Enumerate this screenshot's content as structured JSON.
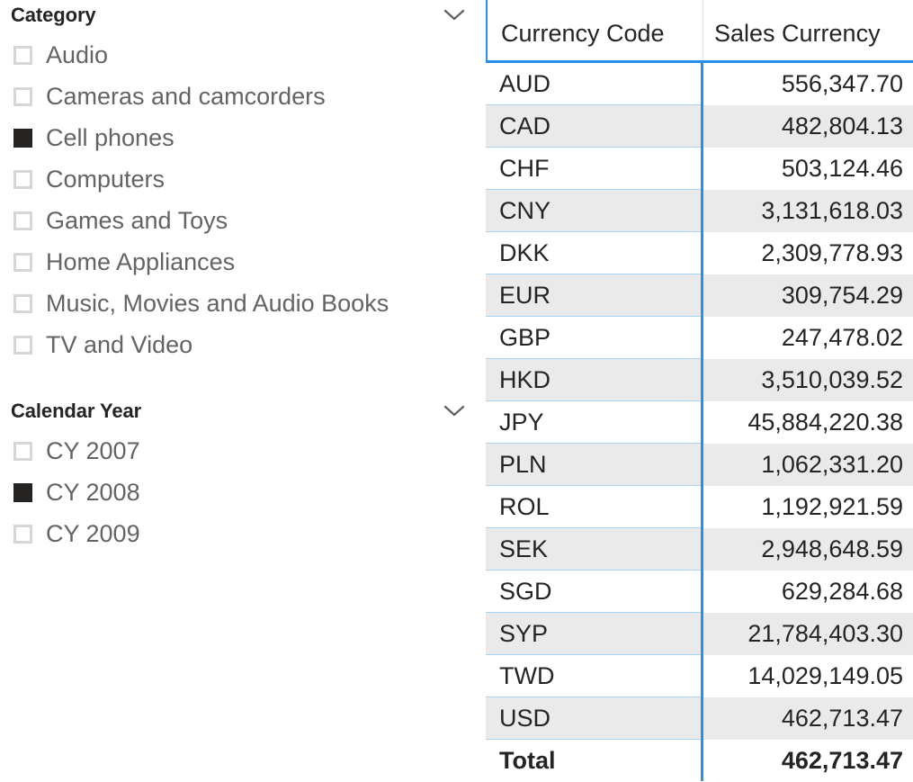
{
  "slicers": [
    {
      "title": "Category",
      "collapse_icon": "chevron-down-icon",
      "items": [
        {
          "label": "Audio",
          "selected": false
        },
        {
          "label": "Cameras and camcorders",
          "selected": false
        },
        {
          "label": "Cell phones",
          "selected": true
        },
        {
          "label": "Computers",
          "selected": false
        },
        {
          "label": "Games and Toys",
          "selected": false
        },
        {
          "label": "Home Appliances",
          "selected": false
        },
        {
          "label": "Music, Movies and Audio Books",
          "selected": false
        },
        {
          "label": "TV and Video",
          "selected": false
        }
      ]
    },
    {
      "title": "Calendar Year",
      "collapse_icon": "chevron-down-icon",
      "items": [
        {
          "label": "CY 2007",
          "selected": false
        },
        {
          "label": "CY 2008",
          "selected": true
        },
        {
          "label": "CY 2009",
          "selected": false
        }
      ]
    }
  ],
  "table": {
    "columns": [
      "Currency Code",
      "Sales Currency"
    ],
    "rows": [
      {
        "code": "AUD",
        "value": "556,347.70"
      },
      {
        "code": "CAD",
        "value": "482,804.13"
      },
      {
        "code": "CHF",
        "value": "503,124.46"
      },
      {
        "code": "CNY",
        "value": "3,131,618.03"
      },
      {
        "code": "DKK",
        "value": "2,309,778.93"
      },
      {
        "code": "EUR",
        "value": "309,754.29"
      },
      {
        "code": "GBP",
        "value": "247,478.02"
      },
      {
        "code": "HKD",
        "value": "3,510,039.52"
      },
      {
        "code": "JPY",
        "value": "45,884,220.38"
      },
      {
        "code": "PLN",
        "value": "1,062,331.20"
      },
      {
        "code": "ROL",
        "value": "1,192,921.59"
      },
      {
        "code": "SEK",
        "value": "2,948,648.59"
      },
      {
        "code": "SGD",
        "value": "629,284.68"
      },
      {
        "code": "SYP",
        "value": "21,784,403.30"
      },
      {
        "code": "TWD",
        "value": "14,029,149.05"
      },
      {
        "code": "USD",
        "value": "462,713.47"
      }
    ],
    "total": {
      "code": "Total",
      "value": "462,713.47"
    }
  },
  "colors": {
    "accent_blue": "#2a8fe8",
    "row_separator": "#a8d4f5",
    "alt_row": "#eaeaea",
    "text": "#252423",
    "slicer_label": "#666362",
    "checkbox_border": "#d6d6d6",
    "checkbox_checked": "#252423"
  }
}
